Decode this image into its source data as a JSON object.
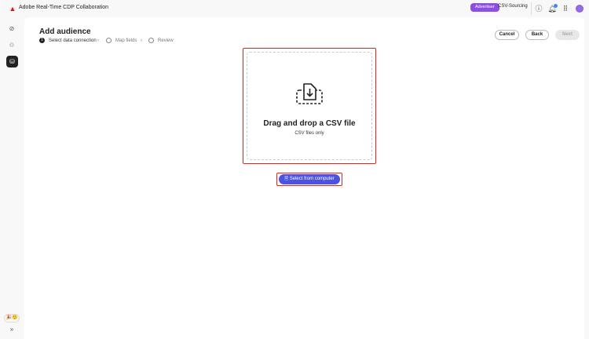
{
  "header": {
    "app_title": "Adobe Real-Time CDP Collaboration",
    "role_badge": "Advertiser",
    "org_name": "CSV-Sourcing"
  },
  "page": {
    "title": "Add audience",
    "steps": [
      {
        "number": "1",
        "label": "Select data connection"
      },
      {
        "label": "Map fields"
      },
      {
        "label": "Review"
      }
    ],
    "buttons": {
      "cancel": "Cancel",
      "back": "Back",
      "next": "Next"
    }
  },
  "dropzone": {
    "title": "Drag and drop a CSV file",
    "subtitle": "CSV files only",
    "select_button": "Select from computer"
  },
  "colors": {
    "accent": "#4b53e0",
    "badge": "#8d4fe0",
    "highlight": "#e0261b"
  }
}
